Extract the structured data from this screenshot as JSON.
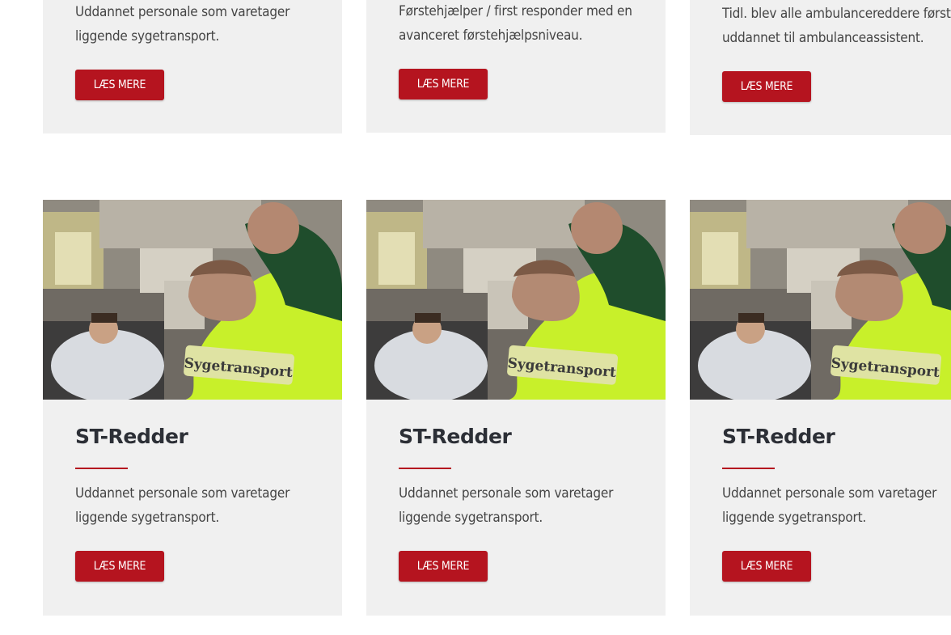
{
  "top_cards": [
    {
      "text_lines": [
        "Uddannet personale som varetager",
        "liggende sygetransport."
      ],
      "button_label": "LÆS MERE"
    },
    {
      "text_lines": [
        "Førstehjælper / first responder med en",
        "avanceret førstehjælpsniveau."
      ],
      "button_label": "LÆS MERE"
    },
    {
      "text_lines": [
        "Tidl. blev alle ambulancereddere først",
        "uddannet til ambulanceassistent."
      ],
      "button_label": "LÆS MERE"
    }
  ],
  "bottom_cards": [
    {
      "image_icon": "ambulance-photo",
      "jacket_label": "Sygetransport",
      "title": "ST-Redder",
      "text_lines": [
        "Uddannet personale som varetager",
        "liggende sygetransport."
      ],
      "button_label": "LÆS MERE"
    },
    {
      "image_icon": "ambulance-photo",
      "jacket_label": "Sygetransport",
      "title": "ST-Redder",
      "text_lines": [
        "Uddannet personale som varetager",
        "liggende sygetransport."
      ],
      "button_label": "LÆS MERE"
    },
    {
      "image_icon": "ambulance-photo",
      "jacket_label": "Sygetransport",
      "title": "ST-Redder",
      "text_lines": [
        "Uddannet personale som varetager",
        "liggende sygetransport."
      ],
      "button_label": "LÆS MERE"
    }
  ],
  "colors": {
    "accent": "#b5141f",
    "card_background": "#f0f0f0",
    "title": "#2c2f36",
    "jacket": "#c8f02a"
  }
}
